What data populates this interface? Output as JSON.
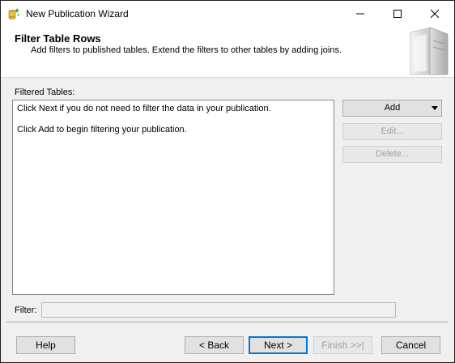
{
  "window": {
    "title": "New Publication Wizard"
  },
  "header": {
    "title": "Filter Table Rows",
    "subtitle": "Add filters to published tables. Extend the filters to other tables by adding joins."
  },
  "filtered_tables": {
    "label": "Filtered Tables:",
    "lines": [
      "Click Next if you do not need to filter the data in your publication.",
      "Click Add to begin filtering your publication."
    ]
  },
  "side_buttons": {
    "add": "Add",
    "edit": "Edit...",
    "delete": "Delete..."
  },
  "filter": {
    "label": "Filter:",
    "value": ""
  },
  "footer": {
    "help": "Help",
    "back": "< Back",
    "next": "Next >",
    "finish": "Finish >>|",
    "cancel": "Cancel"
  },
  "icons": {
    "app": "wizard-app-icon",
    "header_graphic": "database-server-graphic",
    "add_dropdown": "dropdown-arrow-icon"
  },
  "colors": {
    "accent": "#0078d7",
    "disabled_text": "#a0a0a0"
  }
}
